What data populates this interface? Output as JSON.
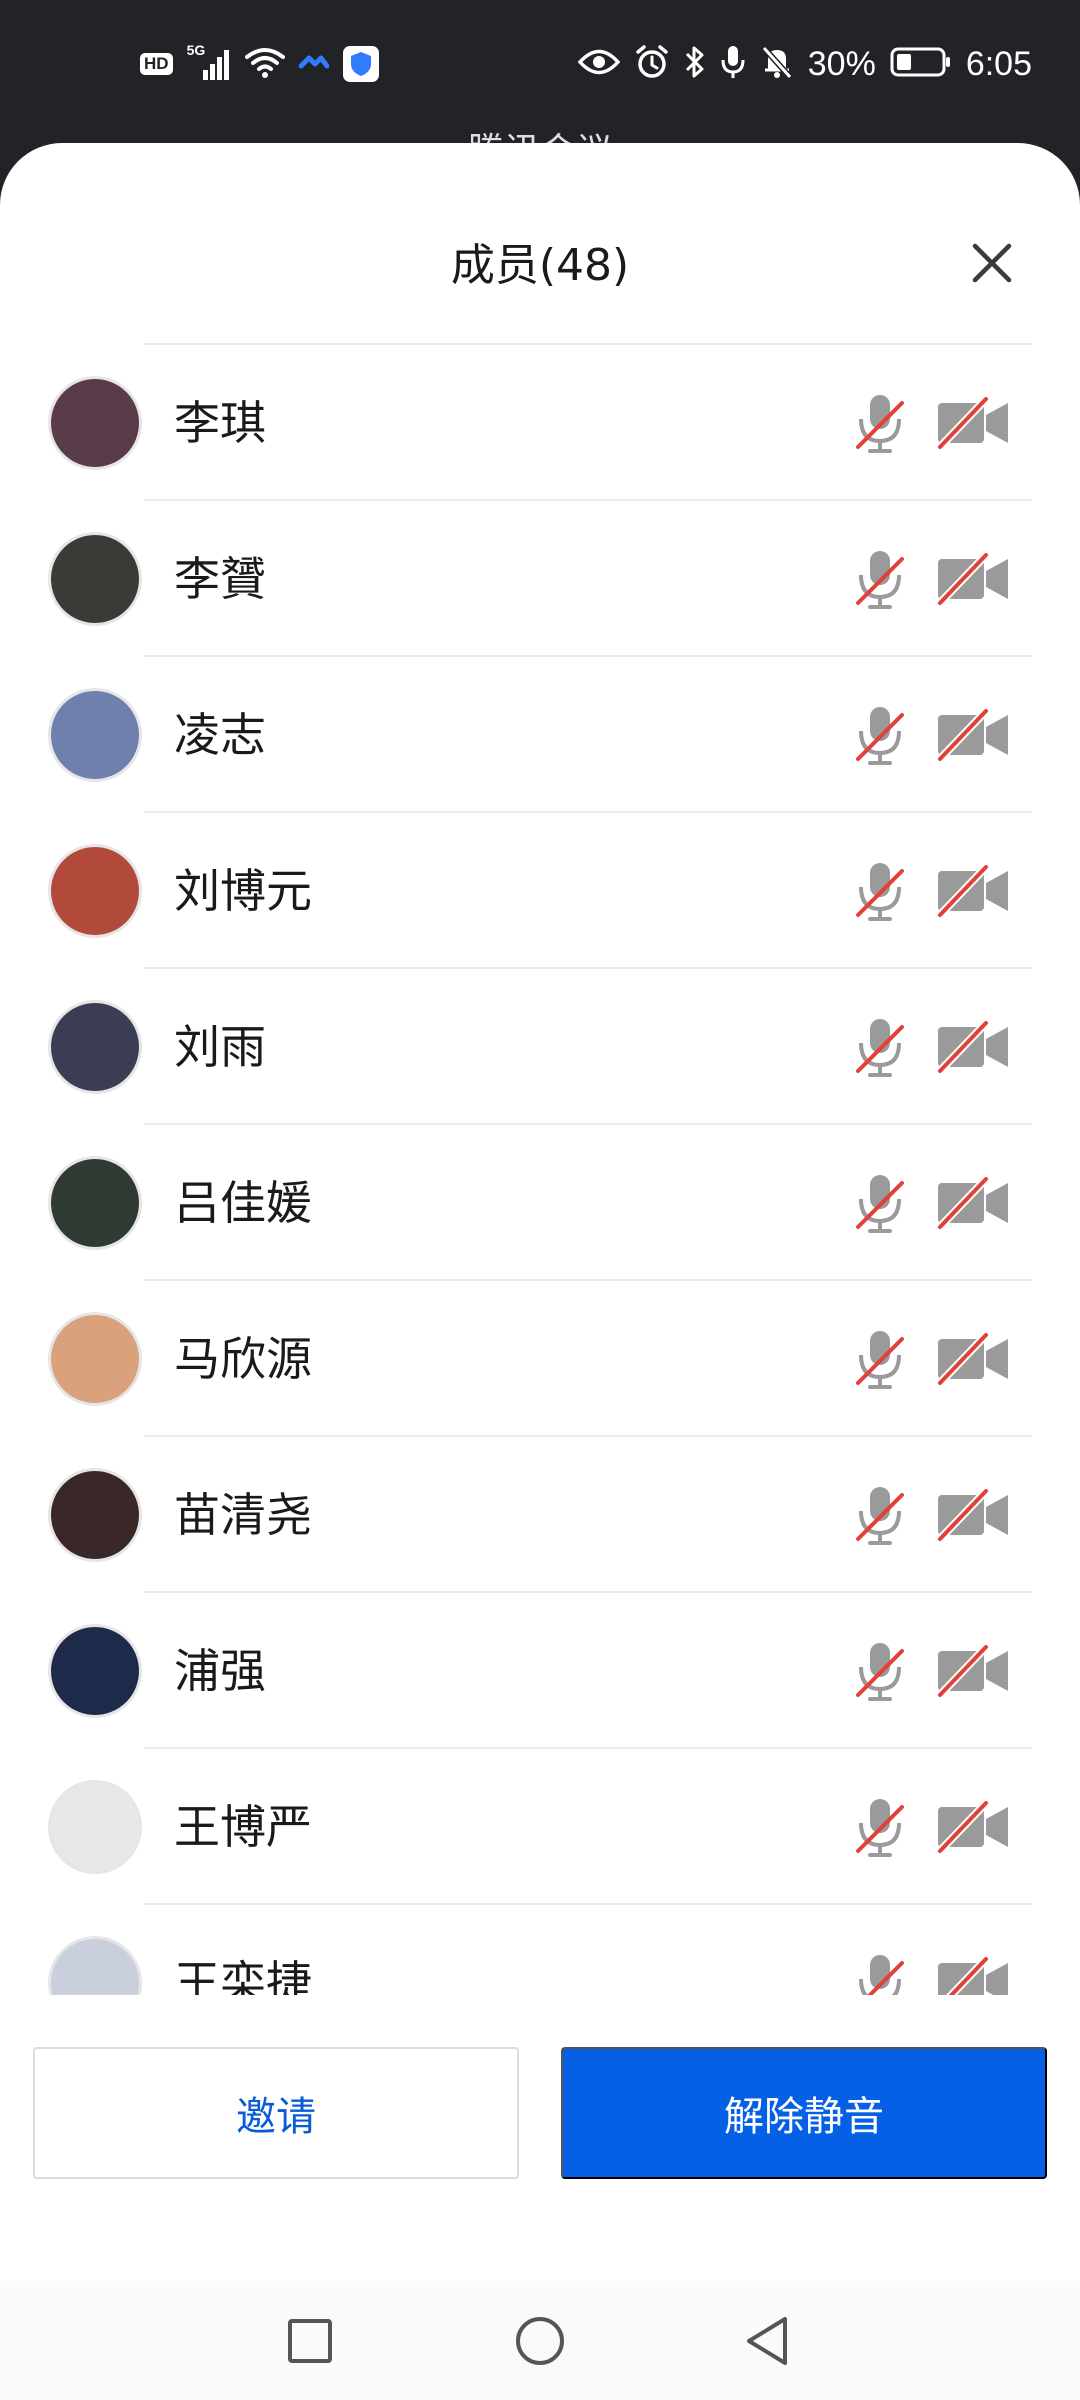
{
  "status_bar": {
    "hd": "HD",
    "network": "5G",
    "battery": "30%",
    "time": "6:05"
  },
  "underlying_title": "腾讯会议",
  "sheet": {
    "title": "成员(48)"
  },
  "members": [
    {
      "name": "李琪",
      "avatar_color": "#5a3b4a",
      "mic_muted": true,
      "camera_off": true
    },
    {
      "name": "李贇",
      "avatar_color": "#3a3a36",
      "mic_muted": true,
      "camera_off": true
    },
    {
      "name": "凌志",
      "avatar_color": "#6f7fae",
      "mic_muted": true,
      "camera_off": true
    },
    {
      "name": "刘博元",
      "avatar_color": "#b24a3c",
      "mic_muted": true,
      "camera_off": true
    },
    {
      "name": "刘雨",
      "avatar_color": "#3b3d55",
      "mic_muted": true,
      "camera_off": true
    },
    {
      "name": "吕佳媛",
      "avatar_color": "#2f3a33",
      "mic_muted": true,
      "camera_off": true
    },
    {
      "name": "马欣源",
      "avatar_color": "#d9a27c",
      "mic_muted": true,
      "camera_off": true
    },
    {
      "name": "苗清尧",
      "avatar_color": "#3a2828",
      "mic_muted": true,
      "camera_off": true
    },
    {
      "name": "浦强",
      "avatar_color": "#1e2a4a",
      "mic_muted": true,
      "camera_off": true
    },
    {
      "name": "王博严",
      "avatar_color": "#e9e6ea",
      "mic_muted": true,
      "camera_off": true
    },
    {
      "name": "王栾捷",
      "avatar_color": "#c9cfdc",
      "mic_muted": true,
      "camera_off": true
    }
  ],
  "buttons": {
    "invite": "邀请",
    "unmute": "解除静音"
  },
  "colors": {
    "primary": "#0560e6",
    "invite_text": "#0a5bd6",
    "muted_strike": "#e0413a"
  }
}
